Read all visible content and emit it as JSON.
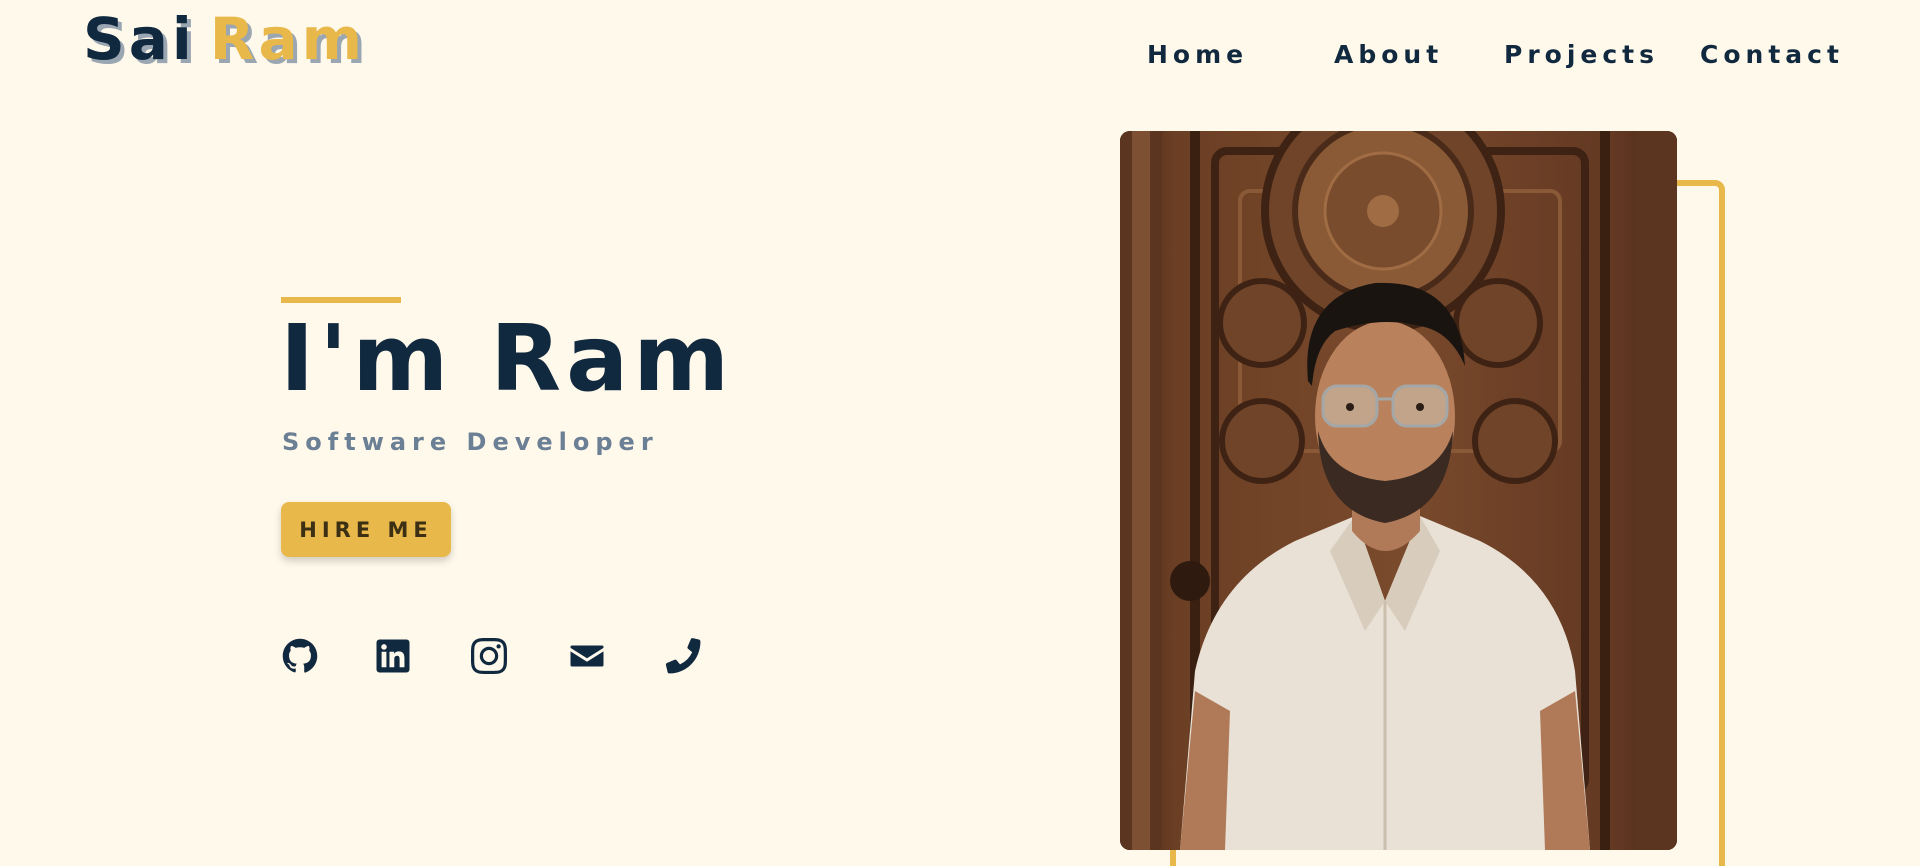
{
  "brand": {
    "first": "Sai",
    "last": "Ram"
  },
  "nav": {
    "home": "Home",
    "about": "About",
    "projects": "Projects",
    "contact": "Contact"
  },
  "hero": {
    "title": "I'm Ram",
    "subtitle": "Software Developer",
    "cta": "HIRE ME"
  },
  "socials": [
    "github-icon",
    "linkedin-icon",
    "instagram-icon",
    "email-icon",
    "phone-icon"
  ],
  "colors": {
    "background": "#fff9eb",
    "navy": "#11293f",
    "accent": "#e8b84a",
    "muted": "#6b7f95"
  }
}
